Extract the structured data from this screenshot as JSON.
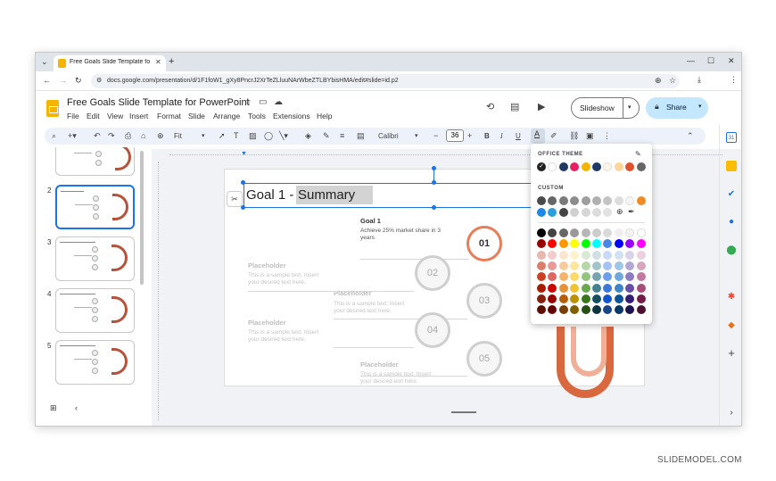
{
  "browser": {
    "tab_title": "Free Goals Slide Template for P",
    "url": "docs.google.com/presentation/d/1F1foW1_gXy8PncrJ2XrTeZLluuNArWbeZTLBYbisHMA/edit#slide=id.p2"
  },
  "app": {
    "doc_title": "Free Goals Slide Template for PowerPoint",
    "menu": [
      "File",
      "Edit",
      "View",
      "Insert",
      "Format",
      "Slide",
      "Arrange",
      "Tools",
      "Extensions",
      "Help"
    ],
    "slideshow_label": "Slideshow",
    "share_label": "Share"
  },
  "toolbar": {
    "zoom": "Fit",
    "font": "Calibri",
    "font_size": "36",
    "bold": "B",
    "italic": "I",
    "underline": "U",
    "text_color": "A"
  },
  "slides_panel": {
    "numbers": [
      "2",
      "3",
      "4",
      "5"
    ],
    "selected": "2"
  },
  "slide": {
    "title_part1": "Goal 1 - ",
    "title_part2": "Summary",
    "goal_title": "Goal 1",
    "goal_text": "Achieve 25% market share in 3 years",
    "placeholder_title": "Placeholder",
    "placeholder_text": "This is a sample text. Insert your desired text here.",
    "numbers": [
      "01",
      "02",
      "03",
      "04",
      "05"
    ]
  },
  "color_picker": {
    "office_theme_label": "OFFICE THEME",
    "custom_label": "CUSTOM",
    "theme_colors": [
      "#222222",
      "#ffffff",
      "#1f3864",
      "#e91e63",
      "#f4b400",
      "#1f3864",
      "#fdf5e6",
      "#ffd59a",
      "#e0522b",
      "#666666"
    ],
    "custom_colors": [
      "#4a4a4a",
      "#666666",
      "#7a7a7a",
      "#8c8c8c",
      "#9e9e9e",
      "#b0b0b0",
      "#c4c4c4",
      "#dcdcdc",
      "#f5f5f5",
      "#f08a24",
      "#1e88e5",
      "#2b9fd9",
      "#444444",
      "#d0d0d0",
      "#d6d6d6",
      "#dcdcdc",
      "#e2e2e2"
    ],
    "palette_rows": [
      [
        "#000000",
        "#434343",
        "#666666",
        "#999999",
        "#b7b7b7",
        "#cccccc",
        "#d9d9d9",
        "#efefef",
        "#f3f3f3",
        "#ffffff"
      ],
      [
        "#980000",
        "#ff0000",
        "#ff9900",
        "#ffff00",
        "#00ff00",
        "#00ffff",
        "#4a86e8",
        "#0000ff",
        "#9900ff",
        "#ff00ff"
      ],
      [
        "#e6b8af",
        "#f4cccc",
        "#fce5cd",
        "#fff2cc",
        "#d9ead3",
        "#d0e0e3",
        "#c9daf8",
        "#cfe2f3",
        "#d9d2e9",
        "#ead1dc"
      ],
      [
        "#dd7e6b",
        "#ea9999",
        "#f9cb9c",
        "#ffe599",
        "#b6d7a8",
        "#a2c4c9",
        "#a4c2f4",
        "#9fc5e8",
        "#b4a7d6",
        "#d5a6bd"
      ],
      [
        "#cc4125",
        "#e06666",
        "#f6b26b",
        "#ffd966",
        "#93c47d",
        "#76a5af",
        "#6d9eeb",
        "#6fa8dc",
        "#8e7cc3",
        "#c27ba0"
      ],
      [
        "#a61c00",
        "#cc0000",
        "#e69138",
        "#f1c232",
        "#6aa84f",
        "#45818e",
        "#3c78d8",
        "#3d85c6",
        "#674ea7",
        "#a64d79"
      ],
      [
        "#85200c",
        "#990000",
        "#b45f06",
        "#bf9000",
        "#38761d",
        "#134f5c",
        "#1155cc",
        "#0b5394",
        "#351c75",
        "#741b47"
      ],
      [
        "#5b0f00",
        "#660000",
        "#783f04",
        "#7f6000",
        "#274e13",
        "#0c343d",
        "#1c4587",
        "#073763",
        "#20124d",
        "#4c1130"
      ]
    ]
  },
  "watermark": "SLIDEMODEL.COM"
}
